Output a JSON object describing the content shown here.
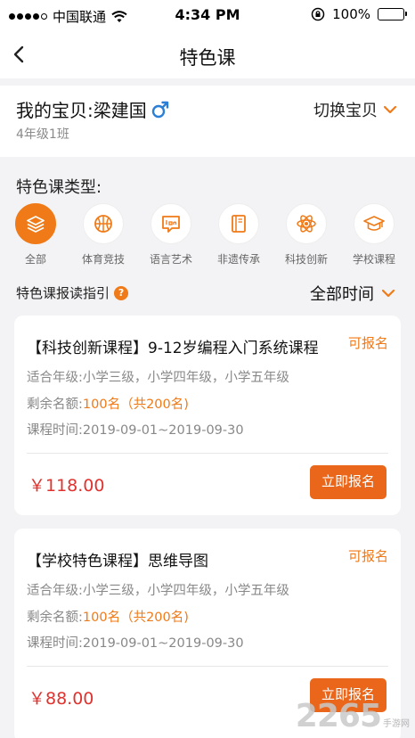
{
  "status_bar": {
    "carrier": "中国联通",
    "time": "4:34 PM",
    "battery": "100%"
  },
  "nav": {
    "title": "特色课"
  },
  "baby": {
    "name": "我的宝贝:梁建国",
    "class_name": "4年级1班",
    "switch_label": "切换宝贝"
  },
  "categories": {
    "section_title": "特色课类型:",
    "items": [
      {
        "label": "全部",
        "icon": "layers-icon",
        "active": true
      },
      {
        "label": "体育竞技",
        "icon": "basketball-icon",
        "active": false
      },
      {
        "label": "语言艺术",
        "icon": "speech-bubble-icon",
        "active": false
      },
      {
        "label": "非遗传承",
        "icon": "book-icon",
        "active": false
      },
      {
        "label": "科技创新",
        "icon": "atom-icon",
        "active": false
      },
      {
        "label": "学校课程",
        "icon": "graduation-cap-icon",
        "active": false
      }
    ]
  },
  "guide": {
    "label": "特色课报读指引",
    "help_icon": "?",
    "time_filter": "全部时间"
  },
  "courses": [
    {
      "title": "【科技创新课程】9-12岁编程入门系统课程",
      "status": "可报名",
      "grades_label": "适合年级:",
      "grades": "小学三级，小学四年级，小学五年级",
      "quota_label": "剩余名额:",
      "quota": "100名（共200名)",
      "time_label": "课程时间:",
      "time": "2019-09-01~2019-09-30",
      "price": "￥118.00",
      "button": "立即报名"
    },
    {
      "title": "【学校特色课程】思维导图",
      "status": "可报名",
      "grades_label": "适合年级:",
      "grades": "小学三级，小学四年级，小学五年级",
      "quota_label": "剩余名额:",
      "quota": "100名（共200名)",
      "time_label": "课程时间:",
      "time": "2019-09-01~2019-09-30",
      "price": "￥88.00",
      "button": "立即报名"
    }
  ],
  "watermark": {
    "number": "2265",
    "text": "手游网"
  },
  "colors": {
    "accent": "#f07a17",
    "button": "#e9661a",
    "price": "#e0322e",
    "male_icon": "#2b7fd6"
  }
}
